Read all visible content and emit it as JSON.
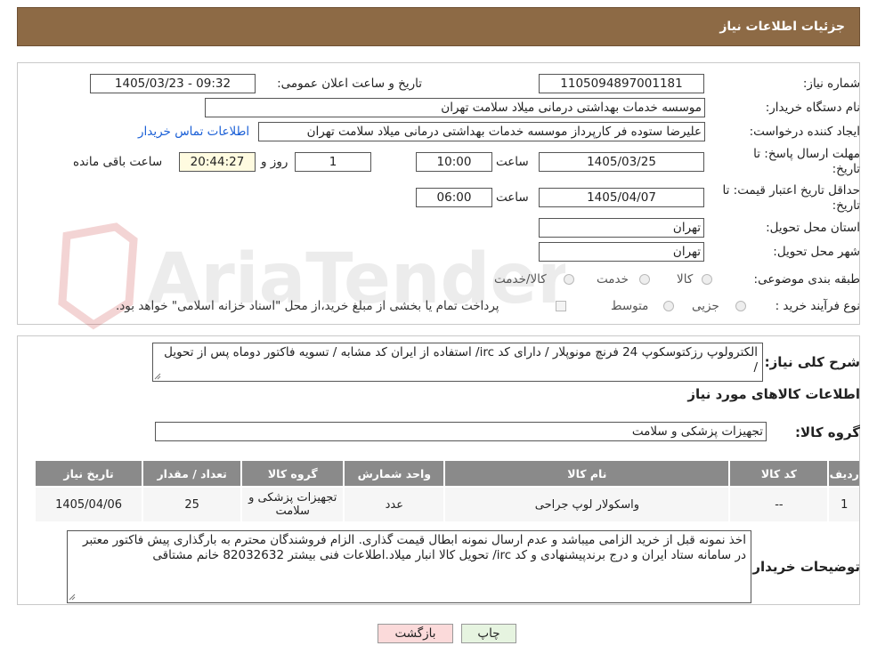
{
  "header": {
    "title": "جزئیات اطلاعات نیاز"
  },
  "watermark": {
    "text": "AriaTender.neT"
  },
  "form": {
    "need_number": {
      "label": "شماره نیاز:",
      "value": "1105094897001181"
    },
    "announce_datetime": {
      "label": "تاریخ و ساعت اعلان عمومی:",
      "value": "1405/03/23 - 09:32"
    },
    "buyer_org": {
      "label": "نام دستگاه خریدار:",
      "value": "موسسه خدمات بهداشتی درمانی میلاد سلامت تهران"
    },
    "requester": {
      "label": "ایجاد کننده درخواست:",
      "value": "علیرضا ستوده فر کارپرداز موسسه خدمات بهداشتی درمانی میلاد سلامت تهران",
      "contact_link": "اطلاعات تماس خریدار"
    },
    "deadline": {
      "label_line1": "مهلت ارسال پاسخ: تا",
      "label_line2": "تاریخ:",
      "date": "1405/03/25",
      "time_label": "ساعت",
      "time": "10:00",
      "days": "1",
      "days_label": "روز و",
      "remaining": "20:44:27",
      "remaining_label": "ساعت باقی مانده"
    },
    "price_validity": {
      "label_line1": "حداقل تاریخ اعتبار قیمت: تا",
      "label_line2": "تاریخ:",
      "date": "1405/04/07",
      "time_label": "ساعت",
      "time": "06:00"
    },
    "province": {
      "label": "استان محل تحویل:",
      "value": "تهران"
    },
    "city": {
      "label": "شهر محل تحویل:",
      "value": "تهران"
    },
    "category": {
      "label": "طبقه بندی موضوعی:",
      "options": [
        "کالا",
        "خدمت",
        "کالا/خدمت"
      ]
    },
    "process": {
      "label": "نوع فرآیند خرید :",
      "options": [
        "جزیی",
        "متوسط"
      ],
      "note": "پرداخت تمام یا بخشی از مبلغ خرید،از محل \"اسناد خزانه اسلامی\" خواهد بود."
    }
  },
  "description": {
    "label": "شرح کلی نیاز:",
    "text": "الکترولوپ رزکتوسکوپ 24 فرنچ مونوپلار / دارای کد irc/ استفاده از ایران کد مشابه / تسویه فاکتور دوماه پس از تحویل /"
  },
  "goods": {
    "title": "اطلاعات کالاهای مورد نیاز",
    "group_label": "گروه کالا:",
    "group_value": "تجهیزات پزشکی و سلامت",
    "columns": [
      "ردیف",
      "کد کالا",
      "نام کالا",
      "واحد شمارش",
      "گروه کالا",
      "تعداد / مقدار",
      "تاریخ نیاز"
    ],
    "rows": [
      {
        "row": "1",
        "code": "--",
        "name": "واسکولار لوپ جراحی",
        "unit": "عدد",
        "group": "تجهیزات پزشکی و سلامت",
        "qty": "25",
        "date": "1405/04/06"
      }
    ]
  },
  "buyer_notes": {
    "label": "توضیحات خریدار:",
    "text": "اخذ نمونه قبل از خرید الزامی میباشد و عدم ارسال نمونه ابطال قیمت گذاری. الزام فروشندگان محترم به بارگذاری پیش فاکتور معتبر در سامانه ستاد ایران و درج برندپیشنهادی و کد irc/  تحویل کالا انبار میلاد.اطلاعات فنی بیشتر 82032632 خانم مشتاقی"
  },
  "buttons": {
    "print": "چاپ",
    "back": "بازگشت"
  },
  "colors": {
    "header_bg": "#8d6a45",
    "back_bg": "#fbdada",
    "print_bg": "#e6f4e0",
    "table_head": "#8a8a8a"
  }
}
